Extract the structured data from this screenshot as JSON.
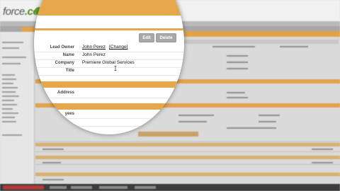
{
  "buttons": {
    "edit": "Edit",
    "delete": "Delete"
  },
  "fields": {
    "lead_owner_label": "Lead Owner",
    "lead_owner_value": "John Perez",
    "lead_owner_change": "[Change]",
    "name_label": "Name",
    "name_value": "John Perez",
    "company_label": "Company",
    "company_value": "Premiere Global Services",
    "title_label": "Title",
    "title_value": ""
  },
  "sections": {
    "address_label": "Address"
  },
  "partial_labels": {
    "label_1": "yees"
  },
  "colors": {
    "accent_orange": "#e5a74a",
    "brand_green": "#6a9d2a"
  }
}
